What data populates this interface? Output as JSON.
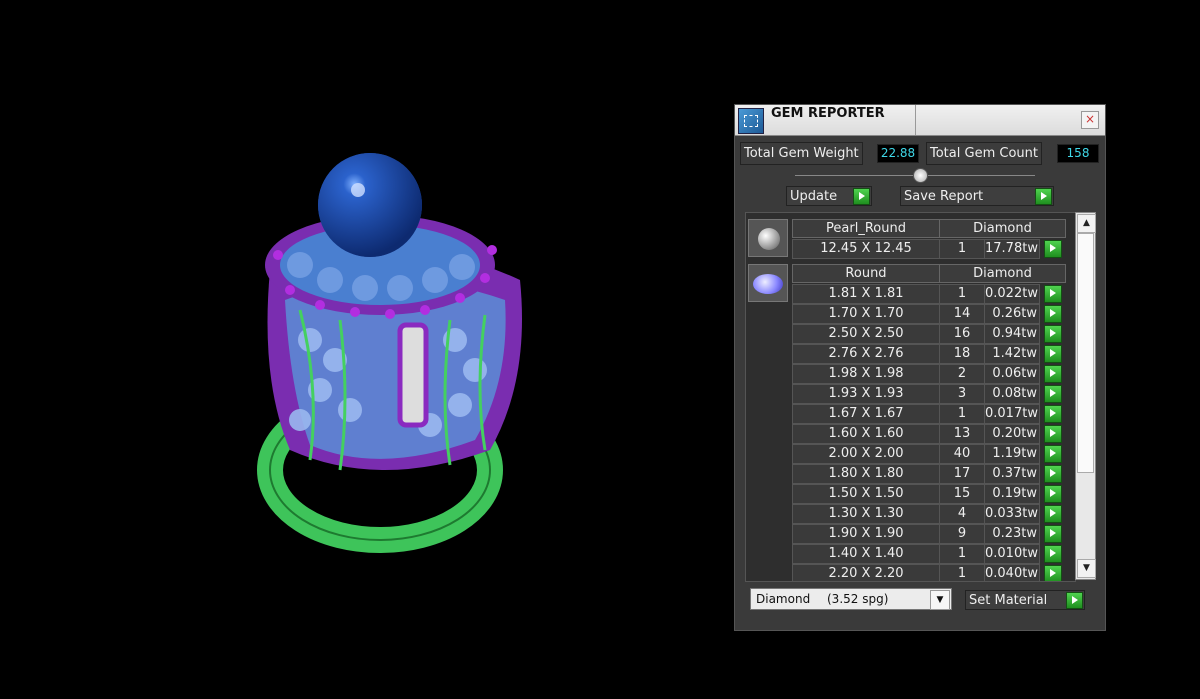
{
  "panel": {
    "title": "GEM REPORTER",
    "close_label": "×",
    "total_weight_label": "Total Gem Weight",
    "total_weight_value": "22.88",
    "total_count_label": "Total Gem Count",
    "total_count_value": "158",
    "update_label": "Update",
    "save_report_label": "Save Report",
    "set_material_label": "Set Material",
    "material_select": {
      "name": "Diamond",
      "spg": "(3.52 spg)"
    }
  },
  "groups": [
    {
      "shape": "Pearl_Round",
      "material": "Diamond",
      "icon": "pearl-icon",
      "rows": [
        {
          "size": "12.45 X 12.45",
          "count": "1",
          "weight": "17.78tw"
        }
      ]
    },
    {
      "shape": "Round",
      "material": "Diamond",
      "icon": "round-gem-icon",
      "rows": [
        {
          "size": "1.81 X 1.81",
          "count": "1",
          "weight": "0.022tw"
        },
        {
          "size": "1.70 X 1.70",
          "count": "14",
          "weight": "0.26tw"
        },
        {
          "size": "2.50 X 2.50",
          "count": "16",
          "weight": "0.94tw"
        },
        {
          "size": "2.76 X 2.76",
          "count": "18",
          "weight": "1.42tw"
        },
        {
          "size": "1.98 X 1.98",
          "count": "2",
          "weight": "0.06tw"
        },
        {
          "size": "1.93 X 1.93",
          "count": "3",
          "weight": "0.08tw"
        },
        {
          "size": "1.67 X 1.67",
          "count": "1",
          "weight": "0.017tw"
        },
        {
          "size": "1.60 X 1.60",
          "count": "13",
          "weight": "0.20tw"
        },
        {
          "size": "2.00 X 2.00",
          "count": "40",
          "weight": "1.19tw"
        },
        {
          "size": "1.80 X 1.80",
          "count": "17",
          "weight": "0.37tw"
        },
        {
          "size": "1.50 X 1.50",
          "count": "15",
          "weight": "0.19tw"
        },
        {
          "size": "1.30 X 1.30",
          "count": "4",
          "weight": "0.033tw"
        },
        {
          "size": "1.90 X 1.90",
          "count": "9",
          "weight": "0.23tw"
        },
        {
          "size": "1.40 X 1.40",
          "count": "1",
          "weight": "0.010tw"
        },
        {
          "size": "2.20 X 2.20",
          "count": "1",
          "weight": "0.040tw"
        }
      ]
    }
  ]
}
